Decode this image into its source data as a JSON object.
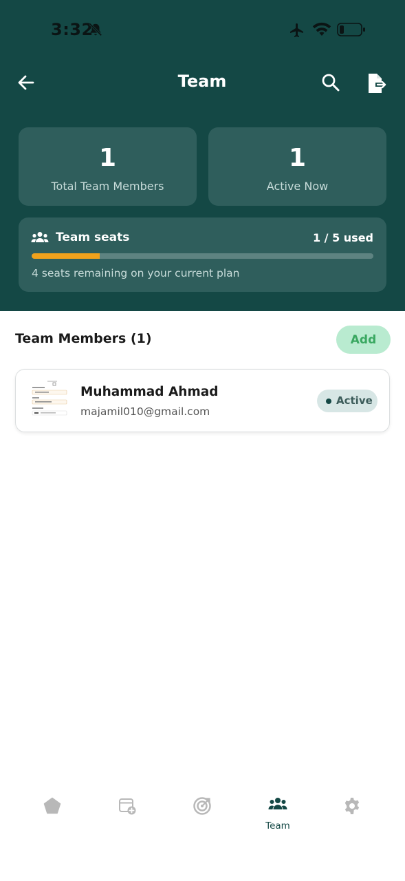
{
  "status_bar": {
    "time": "3:32",
    "icons": [
      "bell-slash-icon",
      "airplane-icon",
      "wifi-icon",
      "battery-icon"
    ]
  },
  "header": {
    "title": "Team",
    "icons": [
      "back-arrow-icon",
      "search-icon",
      "export-icon"
    ]
  },
  "stats": {
    "total_members": {
      "value": "1",
      "label": "Total Team Members"
    },
    "active_now": {
      "value": "1",
      "label": "Active Now"
    }
  },
  "seats": {
    "title": "Team seats",
    "used_label": "1 / 5 used",
    "used": 1,
    "total": 5,
    "remaining_text": "4 seats remaining on your current plan"
  },
  "members_section": {
    "title": "Team Members (1)",
    "add_label": "Add"
  },
  "members": [
    {
      "name": "Muhammad Ahmad",
      "email": "majamil010@gmail.com",
      "status": "Active"
    }
  ],
  "bottom_nav": {
    "tabs": [
      {
        "icon": "pentagon-icon",
        "label": ""
      },
      {
        "icon": "calendar-add-icon",
        "label": ""
      },
      {
        "icon": "target-icon",
        "label": ""
      },
      {
        "icon": "team-icon",
        "label": "Team",
        "active": true
      },
      {
        "icon": "settings-gear-icon",
        "label": ""
      }
    ]
  },
  "colors": {
    "header_bg": "#144845",
    "card_bg": "#2f5e5c",
    "progress_fill": "#f0a21c",
    "add_button_bg": "#b9ebd0",
    "add_button_text": "#3aa861",
    "status_badge_bg": "#d7e6e5",
    "inactive_icon": "#b8b8b8"
  }
}
